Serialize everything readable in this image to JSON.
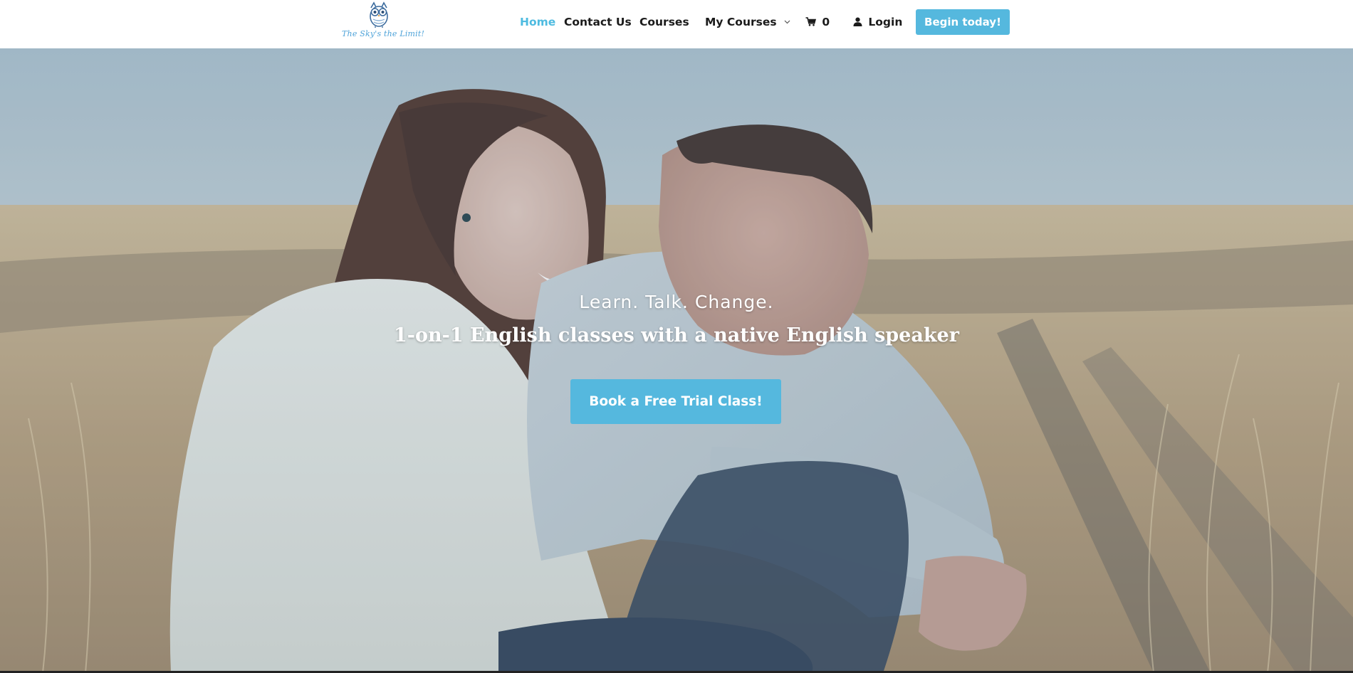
{
  "brand": {
    "logo_text": "The Sky's the Limit!",
    "accent_color": "#55b8de"
  },
  "nav": {
    "items": [
      {
        "label": "Home",
        "active": true
      },
      {
        "label": "Contact Us",
        "active": false
      },
      {
        "label": "Courses",
        "active": false
      },
      {
        "label": "My Courses",
        "active": false,
        "dropdown": true
      },
      {
        "label": "0",
        "icon": "cart-icon"
      },
      {
        "label": "Login",
        "icon": "user-icon"
      }
    ],
    "cta_label": "Begin today!"
  },
  "hero": {
    "tagline": "Learn. Talk. Change.",
    "subtitle": "1-on-1 English classes with a native English speaker",
    "button_label": "Book a Free Trial Class!"
  }
}
